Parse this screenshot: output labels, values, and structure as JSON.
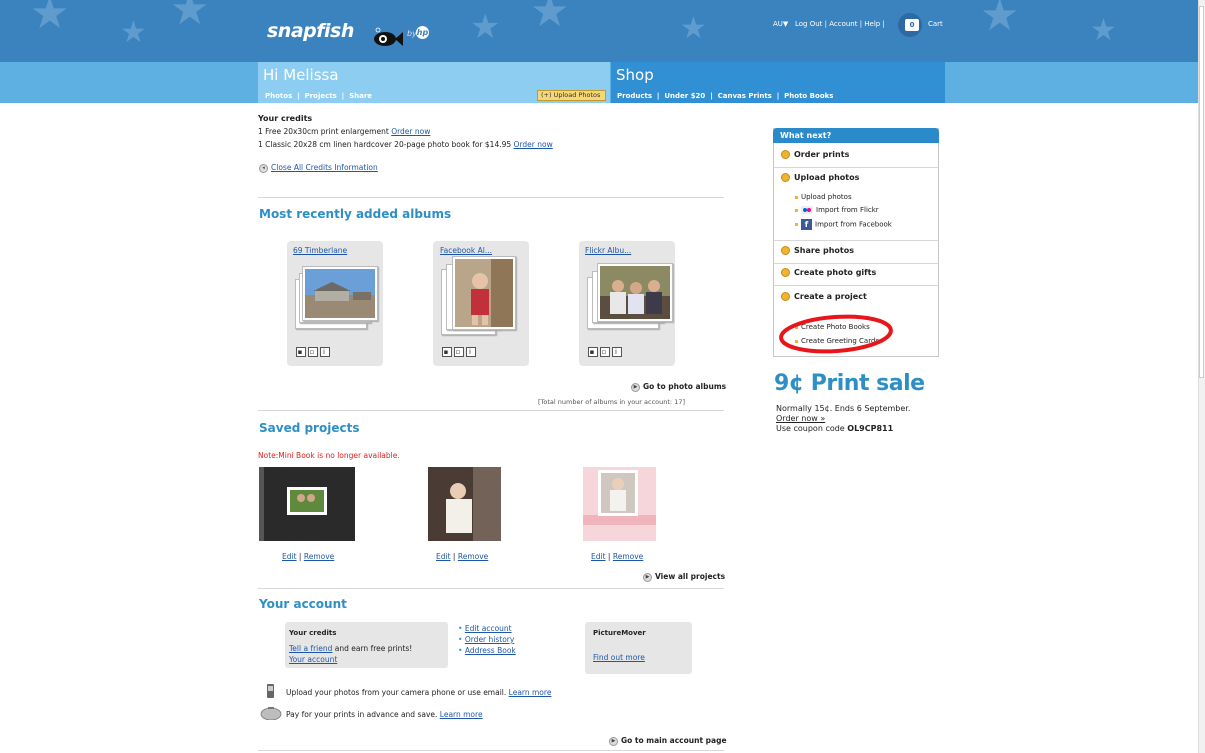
{
  "header": {
    "logo": "snapfish",
    "logo_by": "by",
    "logo_hp": "hp",
    "top_links": [
      "AU▼",
      "Log Out",
      "Account",
      "Help"
    ],
    "cart_count": "0",
    "cart_label": "Cart"
  },
  "nav": {
    "greeting": "Hi Melissa",
    "links": [
      "Photos",
      "Projects",
      "Share"
    ],
    "upload_button": "Upload Photos",
    "shop_title": "Shop",
    "shop_links": [
      "Products",
      "Under $20",
      "Canvas Prints",
      "Photo Books"
    ]
  },
  "credits": {
    "title": "Your credits",
    "line1": "1 Free 20x30cm print enlargement",
    "line2": "1 Classic 20x28 cm linen hardcover 20-page photo book for $14.95",
    "order_now": "Order now",
    "close_all": "Close All Credits Information"
  },
  "albums": {
    "heading": "Most recently added albums",
    "items": [
      {
        "title": "69 Timberlane"
      },
      {
        "title": "Facebook Al..."
      },
      {
        "title": "Flickr Albu..."
      }
    ],
    "go_link": "Go to photo albums",
    "total": "[Total number of albums in your account: 17]"
  },
  "projects": {
    "heading": "Saved projects",
    "note": "Note:Mini Book is no longer available.",
    "edit": "Edit",
    "remove": "Remove",
    "view_all": "View all projects"
  },
  "account": {
    "heading": "Your account",
    "credits_title": "Your credits",
    "tell_friend": "Tell a friend",
    "tell_friend_rest": "and earn free prints!",
    "your_account": "Your account",
    "links": [
      "Edit account",
      "Order history",
      "Address Book"
    ],
    "picturemover": "PictureMover",
    "find_out": "Find out more",
    "mobile_text": "Upload your photos from your camera phone or use email.",
    "prepay_text": "Pay for your prints in advance and save.",
    "learn_more": "Learn more",
    "go_main": "Go to main account page"
  },
  "sidebar": {
    "heading": "What next?",
    "order_prints": "Order prints",
    "upload_photos": "Upload photos",
    "upload_sub": [
      "Upload photos",
      "Import from Flickr",
      "Import from Facebook"
    ],
    "share_photos": "Share photos",
    "create_gifts": "Create photo gifts",
    "create_project": "Create a project",
    "project_sub": [
      "Create Photo Books",
      "Create Greeting Cards"
    ]
  },
  "promo": {
    "title": "9¢ Print sale",
    "line1": "Normally 15¢. Ends 6 September.",
    "order_now": "Order now »",
    "coupon_prefix": "Use coupon code",
    "coupon_code": "OL9CP811"
  },
  "colors": {
    "header_blue": "#3a83bf",
    "nav_light": "#8ccdf1",
    "nav_shop": "#3190d3",
    "heading_blue": "#2e8fc7",
    "link": "#1f57a8",
    "highlight_circle": "#e8151b"
  }
}
